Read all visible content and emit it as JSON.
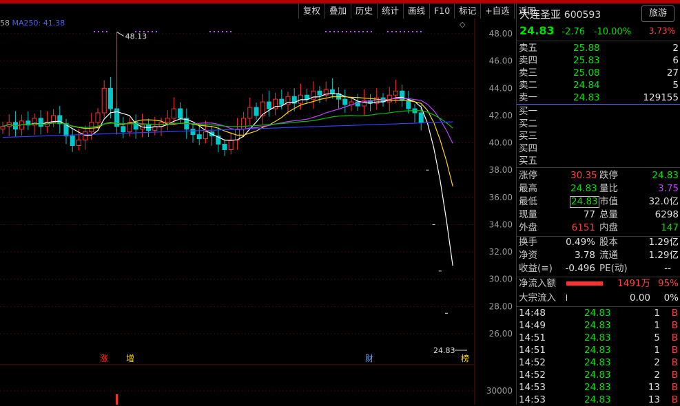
{
  "toolbar": {
    "items": [
      "复权",
      "叠加",
      "历史",
      "统计",
      "画线",
      "F10",
      "标记",
      "+自选",
      "返回"
    ]
  },
  "legend": {
    "lead": "58",
    "ma": "MA250: 41.38"
  },
  "chart": {
    "y_ticks": [
      "48.00",
      "46.00",
      "44.00",
      "42.00",
      "40.00",
      "38.00",
      "36.00",
      "34.00",
      "32.00",
      "30.00",
      "28.00",
      "26.00"
    ],
    "high_label": "48.13",
    "last_label": "24.83",
    "markers": [
      "涨",
      "增",
      "财",
      "榜"
    ],
    "vol_tick": "30000"
  },
  "chart_data": {
    "type": "candlestick",
    "ylim": [
      24.8,
      48.9
    ],
    "high_annotation": 48.13,
    "last_price": 24.83,
    "closes": [
      41.2,
      41.5,
      41.0,
      41.6,
      41.3,
      41.8,
      41.2,
      41.5,
      42.0,
      41.4,
      40.5,
      39.8,
      40.2,
      40.8,
      41.5,
      42.2,
      44.0,
      42.5,
      41.2,
      40.8,
      41.5,
      41.0,
      41.3,
      40.9,
      41.2,
      41.5,
      41.8,
      42.5,
      41.8,
      41.0,
      40.6,
      40.3,
      40.8,
      40.5,
      39.9,
      39.5,
      40.2,
      41.0,
      41.8,
      42.6,
      42.0,
      43.0,
      42.5,
      43.2,
      42.8,
      43.4,
      42.9,
      43.5,
      43.2,
      43.8,
      43.5,
      43.9,
      43.6,
      43.2,
      42.8,
      43.0,
      42.7,
      43.1,
      42.9,
      43.3,
      43.0,
      43.5,
      43.8,
      43.1,
      42.5,
      42.2,
      41.5,
      38.0,
      34.0,
      30.6,
      27.5,
      24.83
    ]
  },
  "quote": {
    "name": "大连圣亚",
    "code": "600593",
    "sector": "旅游",
    "price": "24.83",
    "change": "-2.76",
    "pct": "-10.00%",
    "vol_pct": "3.73%"
  },
  "asks": [
    {
      "label": "卖五",
      "price": "25.88",
      "vol": "2"
    },
    {
      "label": "卖四",
      "price": "25.83",
      "vol": "6"
    },
    {
      "label": "卖三",
      "price": "25.08",
      "vol": "27"
    },
    {
      "label": "卖二",
      "price": "24.84",
      "vol": "5"
    },
    {
      "label": "卖一",
      "price": "24.83",
      "vol": "129155"
    }
  ],
  "bids": [
    {
      "label": "买一"
    },
    {
      "label": "买二"
    },
    {
      "label": "买三"
    },
    {
      "label": "买四"
    },
    {
      "label": "买五"
    }
  ],
  "stats": {
    "zt_l": "涨停",
    "zt_v": "30.35",
    "dt_l": "跌停",
    "dt_v": "24.83",
    "zg_l": "最高",
    "zg_v": "24.83",
    "lb_l": "量比",
    "lb_v": "3.75",
    "zd_l": "最低",
    "zd_v": "24.83",
    "sz_l": "市值",
    "sz_v": "32.0亿",
    "xl_l": "现量",
    "xl_v": "77",
    "zl_l": "总量",
    "zl_v": "6298",
    "wp_l": "外盘",
    "wp_v": "6151",
    "np_l": "内盘",
    "np_v": "147",
    "hs_l": "换手",
    "hs_v": "0.49%",
    "gb_l": "股本",
    "gb_v": "1.29亿",
    "jz_l": "净资",
    "jz_v": "3.78",
    "lt_l": "流通",
    "lt_v": "1.29亿",
    "sy_l": "收益(≡)",
    "sy_v": "-0.496",
    "pe_l": "PE(动)",
    "pe_v": "--"
  },
  "flow": {
    "net_l": "净流入额",
    "net_v": "1491万",
    "net_pct": "95%",
    "net_bar": 0.95,
    "bulk_l": "大宗流入",
    "bulk_v": "0.00",
    "bulk_pct": "0%"
  },
  "trades": [
    {
      "t": "14:48",
      "p": "24.83",
      "v": "1",
      "s": "B"
    },
    {
      "t": "14:49",
      "p": "24.83",
      "v": "1",
      "s": "B"
    },
    {
      "t": "14:51",
      "p": "24.83",
      "v": "5",
      "s": "B"
    },
    {
      "t": "14:51",
      "p": "24.83",
      "v": "1",
      "s": "B"
    },
    {
      "t": "14:52",
      "p": "24.83",
      "v": "2",
      "s": "B"
    },
    {
      "t": "14:52",
      "p": "24.83",
      "v": "2",
      "s": "B"
    },
    {
      "t": "14:53",
      "p": "24.83",
      "v": "13",
      "s": "B"
    },
    {
      "t": "14:53",
      "p": "24.83",
      "v": "13",
      "s": "B"
    }
  ],
  "colors": {
    "up": "#ff3030",
    "down": "#00c8c8",
    "ma5": "#ffffff",
    "ma10": "#ffd700",
    "ma20": "#c040ff",
    "ma60": "#00c000",
    "ma250": "#3040ff"
  }
}
